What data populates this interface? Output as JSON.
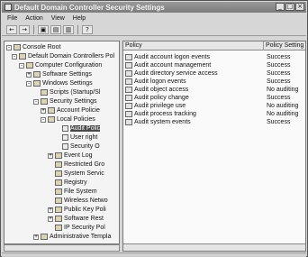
{
  "window": {
    "title": "Default Domain Controller Security Settings"
  },
  "menu": [
    "File",
    "Action",
    "View",
    "Help"
  ],
  "toolbar": [
    "back-arrow-icon",
    "forward-arrow-icon",
    "up-folder-icon",
    "show-hide-tree-icon",
    "export-list-icon",
    "help-icon"
  ],
  "tree": {
    "items": [
      {
        "label": "Console Root",
        "exp": "-"
      },
      {
        "label": "Default Domain Controllers Pol",
        "exp": "-"
      },
      {
        "label": "Computer Configuration",
        "exp": "-"
      },
      {
        "label": "Software Settings",
        "exp": "+"
      },
      {
        "label": "Windows Settings",
        "exp": "-"
      },
      {
        "label": "Scripts (Startup/Sl",
        "exp": ""
      },
      {
        "label": "Security Settings",
        "exp": "-"
      },
      {
        "label": "Account Policie",
        "exp": "+"
      },
      {
        "label": "Local Policies",
        "exp": "-"
      },
      {
        "label": "Audit Polic",
        "exp": "",
        "selected": true
      },
      {
        "label": "User right",
        "exp": ""
      },
      {
        "label": "Security O",
        "exp": ""
      },
      {
        "label": "Event Log",
        "exp": "+"
      },
      {
        "label": "Restricted Gro",
        "exp": ""
      },
      {
        "label": "System Servic",
        "exp": ""
      },
      {
        "label": "Registry",
        "exp": ""
      },
      {
        "label": "File System",
        "exp": ""
      },
      {
        "label": "Wireless Netwo",
        "exp": ""
      },
      {
        "label": "Public Key Poli",
        "exp": "+"
      },
      {
        "label": "Software Rest",
        "exp": "+"
      },
      {
        "label": "IP Security Pol",
        "exp": ""
      },
      {
        "label": "Administrative Templa",
        "exp": "+"
      }
    ]
  },
  "list": {
    "headers": [
      "Policy",
      "Policy Setting"
    ],
    "rows": [
      {
        "policy": "Audit account logon events",
        "setting": "Success"
      },
      {
        "policy": "Audit account management",
        "setting": "Success"
      },
      {
        "policy": "Audit directory service access",
        "setting": "Success"
      },
      {
        "policy": "Audit logon events",
        "setting": "Success"
      },
      {
        "policy": "Audit object access",
        "setting": "No auditing"
      },
      {
        "policy": "Audit policy change",
        "setting": "Success"
      },
      {
        "policy": "Audit privilege use",
        "setting": "No auditing"
      },
      {
        "policy": "Audit process tracking",
        "setting": "No auditing"
      },
      {
        "policy": "Audit system events",
        "setting": "Success"
      }
    ]
  }
}
